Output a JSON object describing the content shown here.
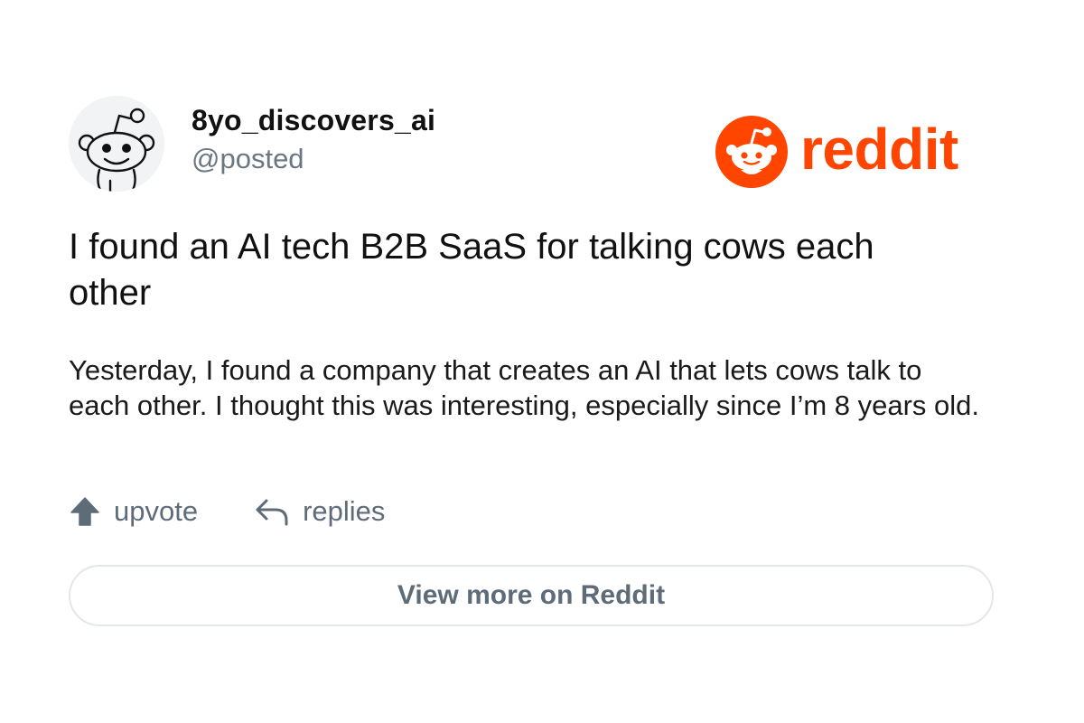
{
  "user": {
    "username": "8yo_discovers_ai",
    "handle": "@posted",
    "avatar_icon": "reddit-snoo-outline-icon"
  },
  "brand": {
    "icon": "reddit-snoo-logo-icon",
    "wordmark": "reddit",
    "color": "#ff4500"
  },
  "post": {
    "title": "I found an AI tech B2B SaaS for talking cows each other",
    "body": "Yesterday, I found a company that creates an AI that lets cows talk to each other. I thought this was interesting, especially since I’m 8 years old."
  },
  "actions": {
    "upvote_label": "upvote",
    "upvote_icon": "upvote-arrow-icon",
    "replies_label": "replies",
    "replies_icon": "reply-arrow-icon"
  },
  "footer": {
    "view_more_label": "View more on Reddit"
  },
  "colors": {
    "muted_text": "#5e6b78",
    "handle_text": "#6b7682",
    "border": "#e3e6ea",
    "avatar_bg": "#f2f3f5"
  }
}
